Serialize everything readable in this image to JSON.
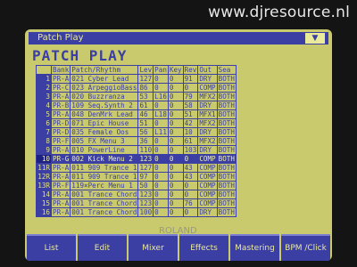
{
  "watermark": "www.djresource.nl",
  "window": {
    "title": "Patch Play",
    "dropdown_icon": "chevron-down-icon"
  },
  "heading": "PATCH PLAY",
  "columns": [
    "",
    "Bank",
    "Patch/Rhythm",
    "Lev",
    "Pan",
    "Key",
    "Rev",
    "Out",
    "Sea"
  ],
  "rows": [
    {
      "num": "1",
      "bank": "PR-A",
      "patch": "021 Cyber Lead",
      "lev": "127",
      "pan": "0",
      "key": "0",
      "rev": "91",
      "out": "DRY",
      "sea": "BOTH"
    },
    {
      "num": "2",
      "bank": "PR-C",
      "patch": "023 ArpeggioBass",
      "lev": "86",
      "pan": "0",
      "key": "0",
      "rev": "0",
      "out": "COMP",
      "sea": "BOTH"
    },
    {
      "num": "3",
      "bank": "PR-A",
      "patch": "020 Buzzranza",
      "lev": "53",
      "pan": "L16",
      "key": "0",
      "rev": "79",
      "out": "MFX2",
      "sea": "BOTH"
    },
    {
      "num": "4",
      "bank": "PR-B",
      "patch": "109 Seq.Synth 2",
      "lev": "61",
      "pan": "0",
      "key": "0",
      "rev": "58",
      "out": "DRY",
      "sea": "BOTH"
    },
    {
      "num": "5",
      "bank": "PR-A",
      "patch": "048 DenMrk Lead",
      "lev": "46",
      "pan": "L18",
      "key": "0",
      "rev": "51",
      "out": "MFX1",
      "sea": "BOTH"
    },
    {
      "num": "6",
      "bank": "PR-D",
      "patch": "071 Epic House",
      "lev": "51",
      "pan": "0",
      "key": "0",
      "rev": "42",
      "out": "MFX2",
      "sea": "BOTH"
    },
    {
      "num": "7",
      "bank": "PR-D",
      "patch": "035 Female Oos",
      "lev": "56",
      "pan": "L11",
      "key": "0",
      "rev": "10",
      "out": "DRY",
      "sea": "BOTH"
    },
    {
      "num": "8",
      "bank": "PR-F",
      "patch": "005 FX Menu 3",
      "lev": "36",
      "pan": "0",
      "key": "0",
      "rev": "61",
      "out": "MFX2",
      "sea": "BOTH"
    },
    {
      "num": "9",
      "bank": "PR-A",
      "patch": "010 PowerLine",
      "lev": "110",
      "pan": "0",
      "key": "0",
      "rev": "103",
      "out": "DRY",
      "sea": "BOTH"
    },
    {
      "num": "10",
      "bank": "PR-G",
      "patch": "002 Kick Menu 2",
      "lev": "123",
      "pan": "0",
      "key": "0",
      "rev": "0",
      "out": "COMP",
      "sea": "BOTH",
      "selected": true
    },
    {
      "num": "11R",
      "bank": "PR-A",
      "patch": "011 909 Trance 1",
      "lev": "127",
      "pan": "0",
      "key": "0",
      "rev": "43",
      "out": "COMP",
      "sea": "BOTH"
    },
    {
      "num": "12R",
      "bank": "PR-A",
      "patch": "011 909 Trance 1",
      "lev": "97",
      "pan": "0",
      "key": "0",
      "rev": "43",
      "out": "COMP",
      "sea": "BOTH"
    },
    {
      "num": "13R",
      "bank": "PR-F",
      "patch": "119×Perc Menu 1",
      "lev": "50",
      "pan": "0",
      "key": "0",
      "rev": "0",
      "out": "COMP",
      "sea": "BOTH"
    },
    {
      "num": "14",
      "bank": "PR-A",
      "patch": "001 Trance Chord",
      "lev": "123",
      "pan": "0",
      "key": "0",
      "rev": "0",
      "out": "COMP",
      "sea": "BOTH"
    },
    {
      "num": "15",
      "bank": "PR-A",
      "patch": "001 Trance Chord",
      "lev": "123",
      "pan": "0",
      "key": "0",
      "rev": "76",
      "out": "COMP",
      "sea": "BOTH"
    },
    {
      "num": "16",
      "bank": "PR-A",
      "patch": "001 Trance Chord",
      "lev": "100",
      "pan": "0",
      "key": "0",
      "rev": "0",
      "out": "DRY",
      "sea": "BOTH"
    }
  ],
  "ghost_text": "ROLAND",
  "buttons": [
    "List",
    "Edit",
    "Mixer",
    "Effects",
    "Mastering",
    "BPM /Click"
  ],
  "colors": {
    "screen_bg": "#c9ca6d",
    "accent": "#3b3ea2",
    "text_light": "#e9ea9a"
  }
}
